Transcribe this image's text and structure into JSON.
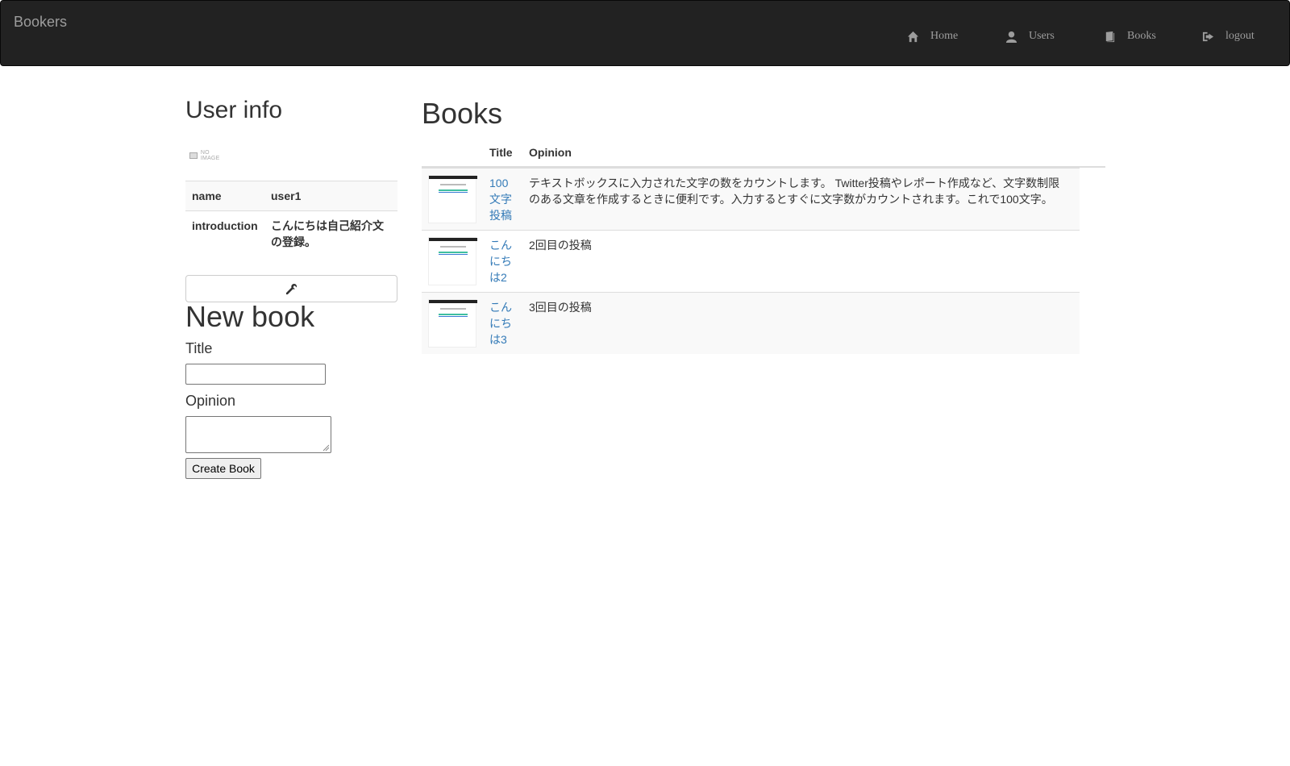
{
  "navbar": {
    "brand": "Bookers",
    "items": [
      {
        "label": "Home",
        "icon": "home-icon"
      },
      {
        "label": "Users",
        "icon": "user-icon"
      },
      {
        "label": "Books",
        "icon": "book-icon"
      },
      {
        "label": "logout",
        "icon": "logout-icon"
      }
    ]
  },
  "user_info": {
    "heading": "User info",
    "no_image_text": "NO IMAGE",
    "rows": [
      {
        "key": "name",
        "value": "user1"
      },
      {
        "key": "introduction",
        "value": "こんにちは自己紹介文の登録。"
      }
    ],
    "edit_icon": "wrench-icon"
  },
  "new_book": {
    "heading": "New book",
    "title_label": "Title",
    "title_value": "",
    "opinion_label": "Opinion",
    "opinion_value": "",
    "submit_label": "Create Book"
  },
  "books": {
    "heading": "Books",
    "columns": [
      "",
      "Title",
      "Opinion"
    ],
    "rows": [
      {
        "title": "100文字投稿",
        "opinion": "テキストボックスに入力された文字の数をカウントします。 Twitter投稿やレポート作成など、文字数制限のある文章を作成するときに便利です。入力するとすぐに文字数がカウントされます。これで100文字。"
      },
      {
        "title": "こんにちは2",
        "opinion": "2回目の投稿"
      },
      {
        "title": "こんにちは3",
        "opinion": "3回目の投稿"
      }
    ]
  },
  "colors": {
    "navbar_bg": "#222222",
    "navbar_text": "#9d9d9d",
    "link": "#337ab7",
    "stripe": "#f9f9f9"
  }
}
